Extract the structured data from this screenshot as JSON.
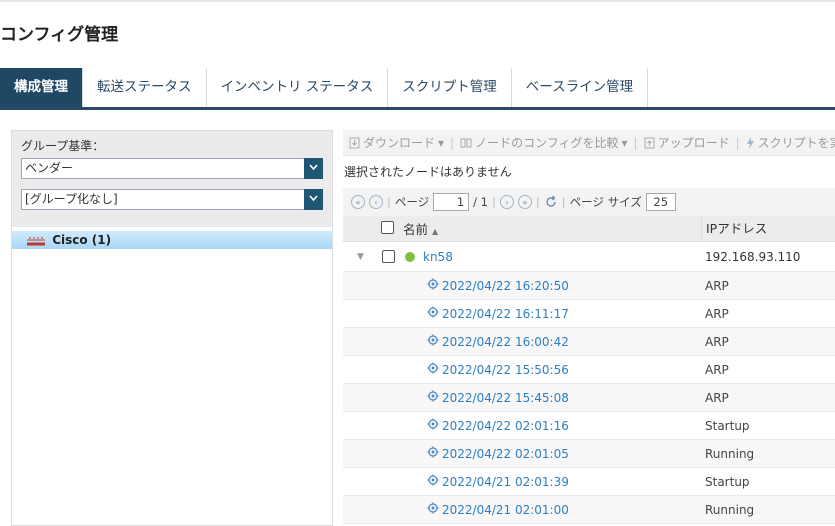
{
  "page": {
    "title": "コンフィグ管理"
  },
  "tabs": [
    {
      "label": "構成管理",
      "active": true
    },
    {
      "label": "転送ステータス",
      "active": false
    },
    {
      "label": "インベントリ ステータス",
      "active": false
    },
    {
      "label": "スクリプト管理",
      "active": false
    },
    {
      "label": "ベースライン管理",
      "active": false
    }
  ],
  "left": {
    "group_label": "グループ基準：",
    "select_vendor": "ベンダー",
    "select_grouping": "[グループ化なし]",
    "tree_item": "Cisco (1)"
  },
  "toolbar": {
    "download": "ダウンロード",
    "compare": "ノードのコンフィグを比較",
    "upload": "アップロード",
    "run_script": "スクリプトを実行"
  },
  "status_message": "選択されたノードはありません",
  "pager": {
    "page_label": "ページ",
    "current_page": "1",
    "total_pages": "/ 1",
    "page_size_label": "ページ サイズ",
    "page_size": "25"
  },
  "grid": {
    "col_name": "名前",
    "col_ip": "IPアドレス",
    "node": {
      "name": "kn58",
      "ip": "192.168.93.110",
      "status_color": "#7cc142"
    },
    "configs": [
      {
        "date": "2022/04/22 16:20:50",
        "type": "ARP"
      },
      {
        "date": "2022/04/22 16:11:17",
        "type": "ARP"
      },
      {
        "date": "2022/04/22 16:00:42",
        "type": "ARP"
      },
      {
        "date": "2022/04/22 15:50:56",
        "type": "ARP"
      },
      {
        "date": "2022/04/22 15:45:08",
        "type": "ARP"
      },
      {
        "date": "2022/04/22 02:01:16",
        "type": "Startup"
      },
      {
        "date": "2022/04/22 02:01:05",
        "type": "Running"
      },
      {
        "date": "2022/04/21 02:01:39",
        "type": "Startup"
      },
      {
        "date": "2022/04/21 02:01:00",
        "type": "Running"
      }
    ]
  },
  "colors": {
    "accent": "#204865",
    "link": "#2f7fc2",
    "select_arrow": "#1e5773"
  }
}
